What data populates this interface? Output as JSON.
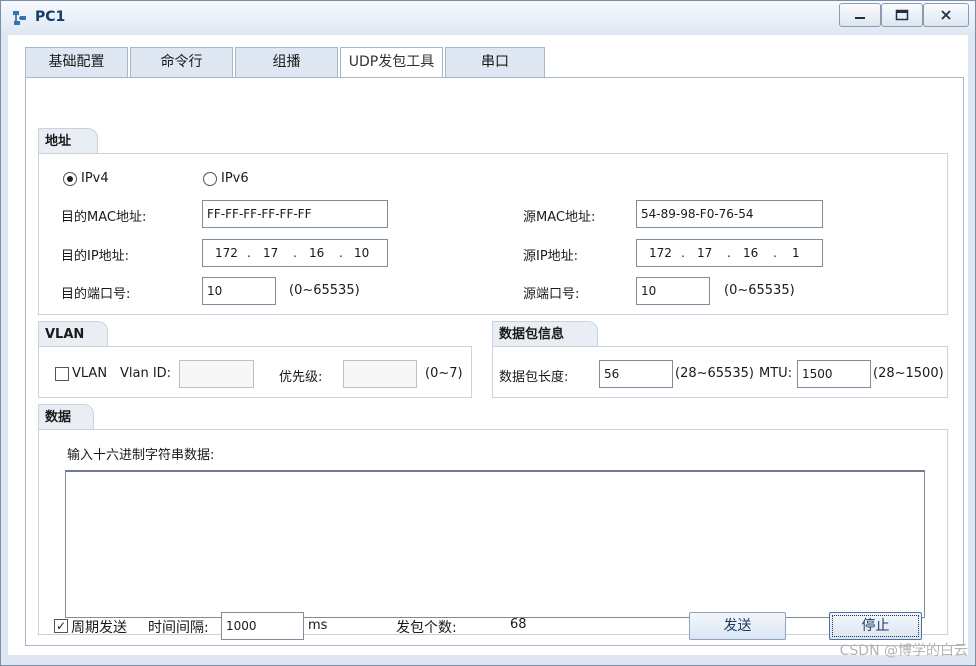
{
  "window": {
    "title": "PC1",
    "minimize_label": "minimize",
    "maximize_label": "maximize",
    "close_label": "close"
  },
  "tabs": [
    {
      "label": "基础配置"
    },
    {
      "label": "命令行"
    },
    {
      "label": "组播"
    },
    {
      "label": "UDP发包工具"
    },
    {
      "label": "串口"
    }
  ],
  "active_tab": "UDP发包工具",
  "address": {
    "group_title": "地址",
    "ipv4_label": "IPv4",
    "ipv6_label": "IPv6",
    "selected_protocol": "IPv4",
    "dst_mac_label": "目的MAC地址:",
    "dst_mac_value": "FF-FF-FF-FF-FF-FF",
    "src_mac_label": "源MAC地址:",
    "src_mac_value": "54-89-98-F0-76-54",
    "dst_ip_label": "目的IP地址:",
    "dst_ip_octets": [
      "172",
      "17",
      "16",
      "10"
    ],
    "src_ip_label": "源IP地址:",
    "src_ip_octets": [
      "172",
      "17",
      "16",
      "1"
    ],
    "ip_dot": ".",
    "dst_port_label": "目的端口号:",
    "dst_port_value": "10",
    "dst_port_range": "(0~65535)",
    "src_port_label": "源端口号:",
    "src_port_value": "10",
    "src_port_range": "(0~65535)"
  },
  "vlan": {
    "group_title": "VLAN",
    "checkbox_label": "VLAN",
    "checked": false,
    "vlan_id_label": "Vlan ID:",
    "vlan_id_value": "",
    "priority_label": "优先级:",
    "priority_value": "",
    "priority_range": "(0~7)"
  },
  "packet_info": {
    "group_title": "数据包信息",
    "length_label": "数据包长度:",
    "length_value": "56",
    "length_range": "(28~65535)",
    "mtu_label": "MTU:",
    "mtu_value": "1500",
    "mtu_range": "(28~1500)"
  },
  "data": {
    "group_title": "数据",
    "prompt": "输入十六进制字符串数据:",
    "hex_value": ""
  },
  "footer": {
    "periodic_label": "周期发送",
    "periodic_checked": true,
    "check_mark": "✓",
    "interval_label": "时间间隔:",
    "interval_value": "1000",
    "interval_unit": "ms",
    "sent_count_label": "发包个数:",
    "sent_count_value": "68",
    "send_button": "发送",
    "stop_button": "停止"
  },
  "watermark": "CSDN @博学的白云"
}
